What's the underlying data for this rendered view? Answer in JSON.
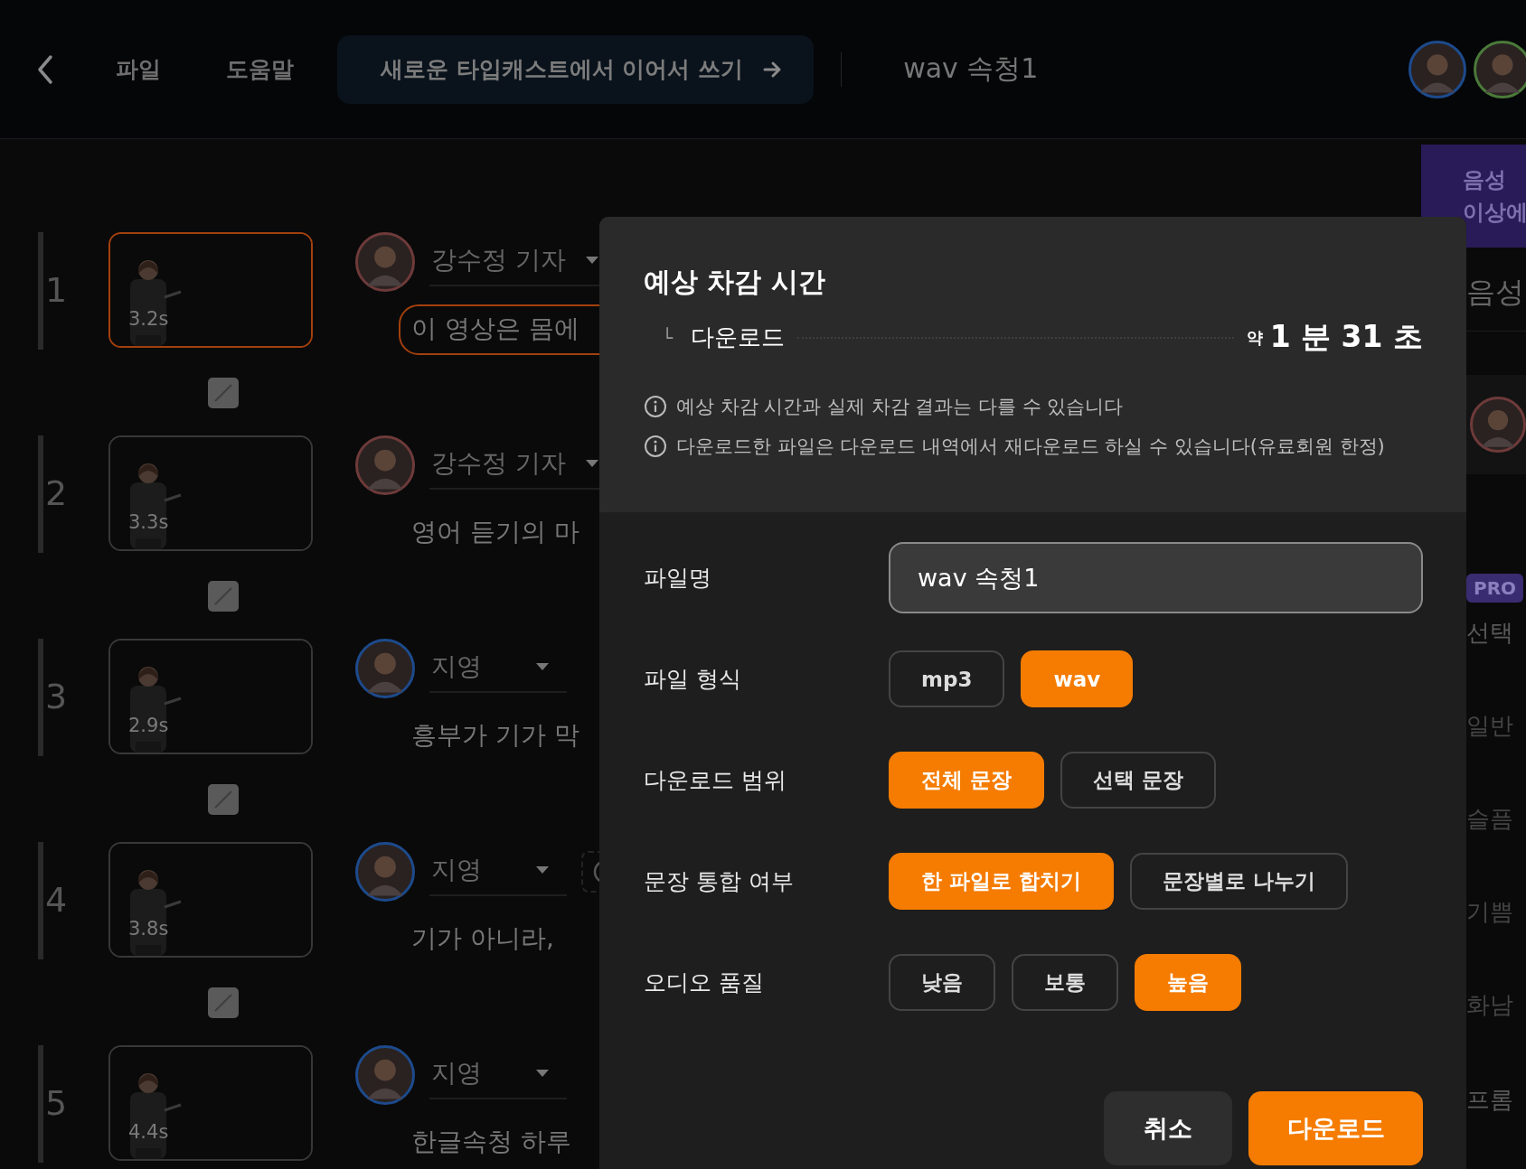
{
  "header": {
    "menu": [
      {
        "label": "파일"
      },
      {
        "label": "도움말"
      }
    ],
    "promo_button": "새로운 타입캐스트에서 이어서 쓰기",
    "document_title": "wav 속청1"
  },
  "sentences": [
    {
      "number": "1",
      "duration": "3.2s",
      "speaker": "강수정 기자",
      "color": "#6e3a3a",
      "text": "이 영상은 몸에",
      "selected": true,
      "pause_chip": false
    },
    {
      "number": "2",
      "duration": "3.3s",
      "speaker": "강수정 기자",
      "color": "#6e3a3a",
      "text": "영어 듣기의 마",
      "selected": false,
      "pause_chip": false
    },
    {
      "number": "3",
      "duration": "2.9s",
      "speaker": "지영",
      "color": "#1d4a8c",
      "text": "흥부가 기가 막",
      "selected": false,
      "pause_chip": false
    },
    {
      "number": "4",
      "duration": "3.8s",
      "speaker": "지영",
      "color": "#1d4a8c",
      "text": "기가 아니라,",
      "selected": false,
      "pause_chip": true
    },
    {
      "number": "5",
      "duration": "4.4s",
      "speaker": "지영",
      "color": "#1d4a8c",
      "text": "한글속청 하루",
      "selected": false,
      "pause_chip": false
    }
  ],
  "right_panel": {
    "banner_lines": [
      "음성",
      "이상에"
    ],
    "heading": "음성",
    "badge": "PRO",
    "section_label": "선택",
    "styles": [
      {
        "label": "일반"
      },
      {
        "label": "슬픔"
      },
      {
        "label": "기쁨"
      },
      {
        "label": "화남"
      }
    ],
    "footer_label": "프롬"
  },
  "modal": {
    "title": "예상 차감 시간",
    "cost_row": {
      "branch": "└",
      "label": "다운로드",
      "prefix": "약",
      "value": "1 분 31 초"
    },
    "notes": [
      "예상 차감 시간과 실제 차감 결과는 다를 수 있습니다",
      "다운로드한 파일은 다운로드 내역에서 재다운로드 하실 수 있습니다(유료회원 한정)"
    ],
    "fields": [
      {
        "kind": "text",
        "label": "파일명",
        "value": "wav 속청1"
      },
      {
        "kind": "choice",
        "label": "파일 형식",
        "options": [
          {
            "label": "mp3",
            "selected": false
          },
          {
            "label": "wav",
            "selected": true
          }
        ]
      },
      {
        "kind": "choice",
        "label": "다운로드 범위",
        "options": [
          {
            "label": "전체 문장",
            "selected": true
          },
          {
            "label": "선택 문장",
            "selected": false
          }
        ]
      },
      {
        "kind": "choice",
        "label": "문장 통합 여부",
        "options": [
          {
            "label": "한 파일로 합치기",
            "selected": true
          },
          {
            "label": "문장별로 나누기",
            "selected": false
          }
        ]
      },
      {
        "kind": "choice",
        "label": "오디오 품질",
        "options": [
          {
            "label": "낮음",
            "selected": false
          },
          {
            "label": "보통",
            "selected": false
          },
          {
            "label": "높음",
            "selected": true
          }
        ]
      }
    ],
    "buttons": [
      {
        "label": "취소",
        "kind": "secondary"
      },
      {
        "label": "다운로드",
        "kind": "primary"
      }
    ]
  }
}
